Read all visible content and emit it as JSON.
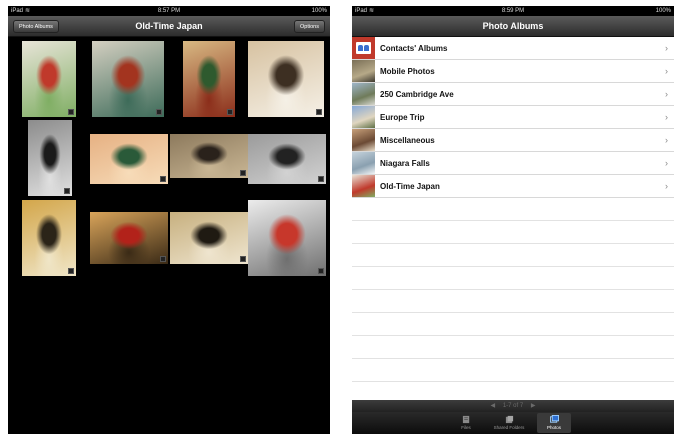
{
  "left": {
    "status": {
      "carrier": "iPad",
      "time": "8:57 PM",
      "battery": "100%"
    },
    "nav": {
      "back_label": "Photo Albums",
      "title": "Old-Time Japan",
      "options_label": "Options"
    },
    "photos": [
      {
        "subject": "doll-with-red-hat",
        "colors": [
          "#e8e4d8",
          "#c0392b",
          "#7fae63"
        ]
      },
      {
        "subject": "blurred-doll",
        "colors": [
          "#d4cfc1",
          "#a3341f",
          "#3d6b59"
        ]
      },
      {
        "subject": "bonsai-dolls",
        "colors": [
          "#d8b983",
          "#2e5a2e",
          "#8b2d1a"
        ]
      },
      {
        "subject": "warrior-doll",
        "colors": [
          "#d7c2a1",
          "#3d2f22",
          "#f5f0e6"
        ]
      },
      {
        "subject": "bw-doll",
        "colors": [
          "#8c8c8c",
          "#1a1a1a",
          "#e0e0e0"
        ]
      },
      {
        "subject": "painted-landscape",
        "colors": [
          "#e6b183",
          "#2a5a39",
          "#f7dcb9"
        ]
      },
      {
        "subject": "doll-row",
        "colors": [
          "#8d7a5d",
          "#2a221b",
          "#c9b694"
        ]
      },
      {
        "subject": "bw-figures",
        "colors": [
          "#9b9b9b",
          "#222222",
          "#d2d2d2"
        ]
      },
      {
        "subject": "golden-crown-doll",
        "colors": [
          "#d3a64a",
          "#2b2418",
          "#f0e6c8"
        ]
      },
      {
        "subject": "red-kimono-doll",
        "colors": [
          "#d9a45a",
          "#b2221a",
          "#3a2a16"
        ]
      },
      {
        "subject": "emperor-empress",
        "colors": [
          "#c7b07f",
          "#1f1a12",
          "#efe5cf"
        ]
      },
      {
        "subject": "white-rabbit-cart",
        "colors": [
          "#ececec",
          "#c7372b",
          "#6f6f6f"
        ]
      }
    ]
  },
  "right": {
    "status": {
      "carrier": "iPad",
      "time": "8:59 PM",
      "battery": "100%"
    },
    "nav": {
      "title": "Photo Albums"
    },
    "albums": [
      {
        "label": "Contacts' Albums",
        "thumb": [
          "#c0392b",
          "#ffffff",
          "#3b6fd0"
        ]
      },
      {
        "label": "Mobile Photos",
        "thumb": [
          "#7a6f57",
          "#b6a988",
          "#3e3a30"
        ]
      },
      {
        "label": "250 Cambridge Ave",
        "thumb": [
          "#9fb6c9",
          "#6f7b5a",
          "#d8d8d0"
        ]
      },
      {
        "label": "Europe Trip",
        "thumb": [
          "#87a9d6",
          "#e0d6c0",
          "#5d6f44"
        ]
      },
      {
        "label": "Miscellaneous",
        "thumb": [
          "#c7a07a",
          "#6b4a34",
          "#e8dcc8"
        ]
      },
      {
        "label": "Niagara Falls",
        "thumb": [
          "#c6d3dc",
          "#8aa0b0",
          "#f2f4f6"
        ]
      },
      {
        "label": "Old-Time Japan",
        "thumb": [
          "#e8e4d8",
          "#c0392b",
          "#7fae63"
        ]
      }
    ],
    "pager": {
      "prev": "◀",
      "text": "1-7 of 7",
      "next": "▶"
    },
    "tabs": [
      {
        "label": "Files",
        "icon": "files-icon"
      },
      {
        "label": "Shared Folders",
        "icon": "shared-folders-icon"
      },
      {
        "label": "Photos",
        "icon": "photos-icon",
        "active": true
      }
    ],
    "chevron": "›"
  }
}
